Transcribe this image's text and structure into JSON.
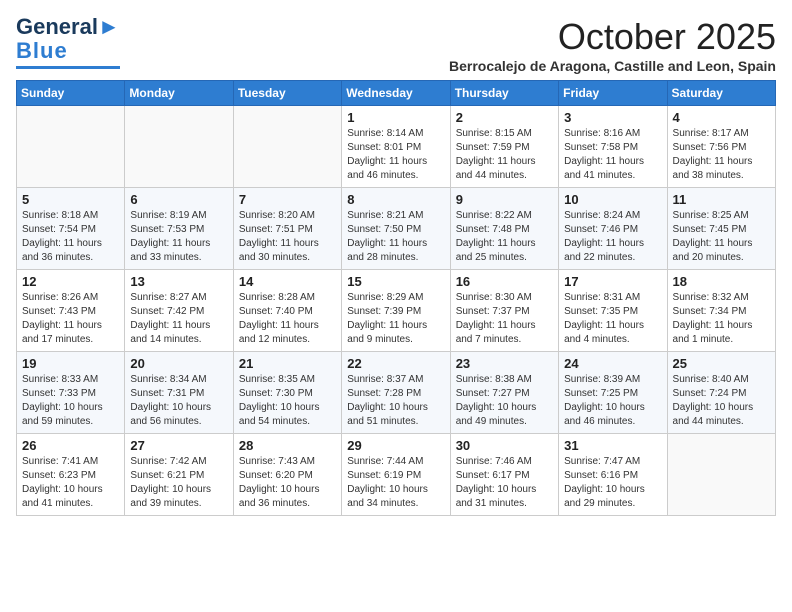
{
  "header": {
    "logo_line1": "General",
    "logo_line2": "Blue",
    "month_title": "October 2025",
    "subtitle": "Berrocalejo de Aragona, Castille and Leon, Spain"
  },
  "weekdays": [
    "Sunday",
    "Monday",
    "Tuesday",
    "Wednesday",
    "Thursday",
    "Friday",
    "Saturday"
  ],
  "weeks": [
    [
      {
        "day": "",
        "info": ""
      },
      {
        "day": "",
        "info": ""
      },
      {
        "day": "",
        "info": ""
      },
      {
        "day": "1",
        "info": "Sunrise: 8:14 AM\nSunset: 8:01 PM\nDaylight: 11 hours and 46 minutes."
      },
      {
        "day": "2",
        "info": "Sunrise: 8:15 AM\nSunset: 7:59 PM\nDaylight: 11 hours and 44 minutes."
      },
      {
        "day": "3",
        "info": "Sunrise: 8:16 AM\nSunset: 7:58 PM\nDaylight: 11 hours and 41 minutes."
      },
      {
        "day": "4",
        "info": "Sunrise: 8:17 AM\nSunset: 7:56 PM\nDaylight: 11 hours and 38 minutes."
      }
    ],
    [
      {
        "day": "5",
        "info": "Sunrise: 8:18 AM\nSunset: 7:54 PM\nDaylight: 11 hours and 36 minutes."
      },
      {
        "day": "6",
        "info": "Sunrise: 8:19 AM\nSunset: 7:53 PM\nDaylight: 11 hours and 33 minutes."
      },
      {
        "day": "7",
        "info": "Sunrise: 8:20 AM\nSunset: 7:51 PM\nDaylight: 11 hours and 30 minutes."
      },
      {
        "day": "8",
        "info": "Sunrise: 8:21 AM\nSunset: 7:50 PM\nDaylight: 11 hours and 28 minutes."
      },
      {
        "day": "9",
        "info": "Sunrise: 8:22 AM\nSunset: 7:48 PM\nDaylight: 11 hours and 25 minutes."
      },
      {
        "day": "10",
        "info": "Sunrise: 8:24 AM\nSunset: 7:46 PM\nDaylight: 11 hours and 22 minutes."
      },
      {
        "day": "11",
        "info": "Sunrise: 8:25 AM\nSunset: 7:45 PM\nDaylight: 11 hours and 20 minutes."
      }
    ],
    [
      {
        "day": "12",
        "info": "Sunrise: 8:26 AM\nSunset: 7:43 PM\nDaylight: 11 hours and 17 minutes."
      },
      {
        "day": "13",
        "info": "Sunrise: 8:27 AM\nSunset: 7:42 PM\nDaylight: 11 hours and 14 minutes."
      },
      {
        "day": "14",
        "info": "Sunrise: 8:28 AM\nSunset: 7:40 PM\nDaylight: 11 hours and 12 minutes."
      },
      {
        "day": "15",
        "info": "Sunrise: 8:29 AM\nSunset: 7:39 PM\nDaylight: 11 hours and 9 minutes."
      },
      {
        "day": "16",
        "info": "Sunrise: 8:30 AM\nSunset: 7:37 PM\nDaylight: 11 hours and 7 minutes."
      },
      {
        "day": "17",
        "info": "Sunrise: 8:31 AM\nSunset: 7:35 PM\nDaylight: 11 hours and 4 minutes."
      },
      {
        "day": "18",
        "info": "Sunrise: 8:32 AM\nSunset: 7:34 PM\nDaylight: 11 hours and 1 minute."
      }
    ],
    [
      {
        "day": "19",
        "info": "Sunrise: 8:33 AM\nSunset: 7:33 PM\nDaylight: 10 hours and 59 minutes."
      },
      {
        "day": "20",
        "info": "Sunrise: 8:34 AM\nSunset: 7:31 PM\nDaylight: 10 hours and 56 minutes."
      },
      {
        "day": "21",
        "info": "Sunrise: 8:35 AM\nSunset: 7:30 PM\nDaylight: 10 hours and 54 minutes."
      },
      {
        "day": "22",
        "info": "Sunrise: 8:37 AM\nSunset: 7:28 PM\nDaylight: 10 hours and 51 minutes."
      },
      {
        "day": "23",
        "info": "Sunrise: 8:38 AM\nSunset: 7:27 PM\nDaylight: 10 hours and 49 minutes."
      },
      {
        "day": "24",
        "info": "Sunrise: 8:39 AM\nSunset: 7:25 PM\nDaylight: 10 hours and 46 minutes."
      },
      {
        "day": "25",
        "info": "Sunrise: 8:40 AM\nSunset: 7:24 PM\nDaylight: 10 hours and 44 minutes."
      }
    ],
    [
      {
        "day": "26",
        "info": "Sunrise: 7:41 AM\nSunset: 6:23 PM\nDaylight: 10 hours and 41 minutes."
      },
      {
        "day": "27",
        "info": "Sunrise: 7:42 AM\nSunset: 6:21 PM\nDaylight: 10 hours and 39 minutes."
      },
      {
        "day": "28",
        "info": "Sunrise: 7:43 AM\nSunset: 6:20 PM\nDaylight: 10 hours and 36 minutes."
      },
      {
        "day": "29",
        "info": "Sunrise: 7:44 AM\nSunset: 6:19 PM\nDaylight: 10 hours and 34 minutes."
      },
      {
        "day": "30",
        "info": "Sunrise: 7:46 AM\nSunset: 6:17 PM\nDaylight: 10 hours and 31 minutes."
      },
      {
        "day": "31",
        "info": "Sunrise: 7:47 AM\nSunset: 6:16 PM\nDaylight: 10 hours and 29 minutes."
      },
      {
        "day": "",
        "info": ""
      }
    ]
  ]
}
